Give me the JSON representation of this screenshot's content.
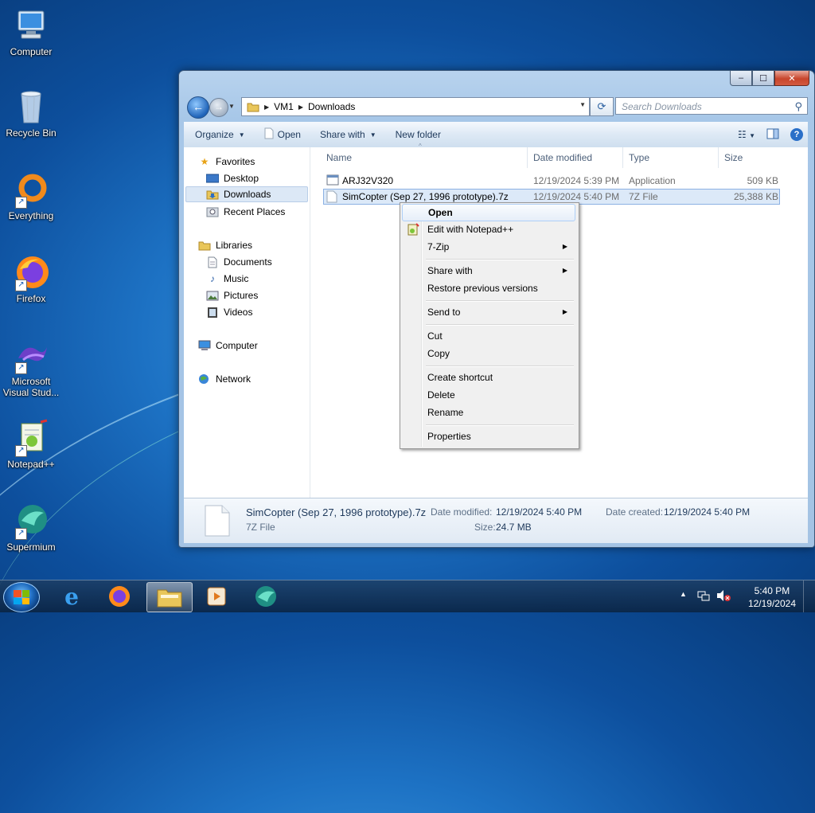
{
  "desktop": {
    "icons": [
      {
        "label": "Computer"
      },
      {
        "label": "Recycle Bin"
      },
      {
        "label": "Everything"
      },
      {
        "label": "Firefox"
      },
      {
        "label": "Microsoft Visual Stud..."
      },
      {
        "label": "Notepad++"
      },
      {
        "label": "Supermium"
      }
    ]
  },
  "window": {
    "caption": {
      "minimize": "‒",
      "maximize": "☐",
      "close": "✕"
    },
    "address": {
      "segments": [
        "VM1",
        "Downloads"
      ]
    },
    "search": {
      "placeholder": "Search Downloads"
    },
    "toolbar": {
      "organize": "Organize",
      "open": "Open",
      "share_with": "Share with",
      "new_folder": "New folder"
    },
    "nav": {
      "favorites": "Favorites",
      "desktop": "Desktop",
      "downloads": "Downloads",
      "recent_places": "Recent Places",
      "libraries": "Libraries",
      "documents": "Documents",
      "music": "Music",
      "pictures": "Pictures",
      "videos": "Videos",
      "computer": "Computer",
      "network": "Network"
    },
    "columns": {
      "name": "Name",
      "date_modified": "Date modified",
      "type": "Type",
      "size": "Size"
    },
    "files": [
      {
        "name": "ARJ32V320",
        "date": "12/19/2024 5:39 PM",
        "type": "Application",
        "size": "509 KB"
      },
      {
        "name": "SimCopter (Sep 27, 1996 prototype).7z",
        "date": "12/19/2024 5:40 PM",
        "type": "7Z File",
        "size": "25,388 KB"
      }
    ],
    "details": {
      "filename": "SimCopter (Sep 27, 1996 prototype).7z",
      "filetype": "7Z File",
      "date_modified_label": "Date modified:",
      "date_modified": "12/19/2024 5:40 PM",
      "date_created_label": "Date created:",
      "date_created": "12/19/2024 5:40 PM",
      "size_label": "Size:",
      "size": "24.7 MB"
    }
  },
  "context_menu": {
    "open": "Open",
    "edit_notepad": "Edit with Notepad++",
    "seven_zip": "7-Zip",
    "share_with": "Share with",
    "restore": "Restore previous versions",
    "send_to": "Send to",
    "cut": "Cut",
    "copy": "Copy",
    "create_shortcut": "Create shortcut",
    "delete": "Delete",
    "rename": "Rename",
    "properties": "Properties"
  },
  "taskbar": {
    "clock_time": "5:40 PM",
    "clock_date": "12/19/2024"
  }
}
